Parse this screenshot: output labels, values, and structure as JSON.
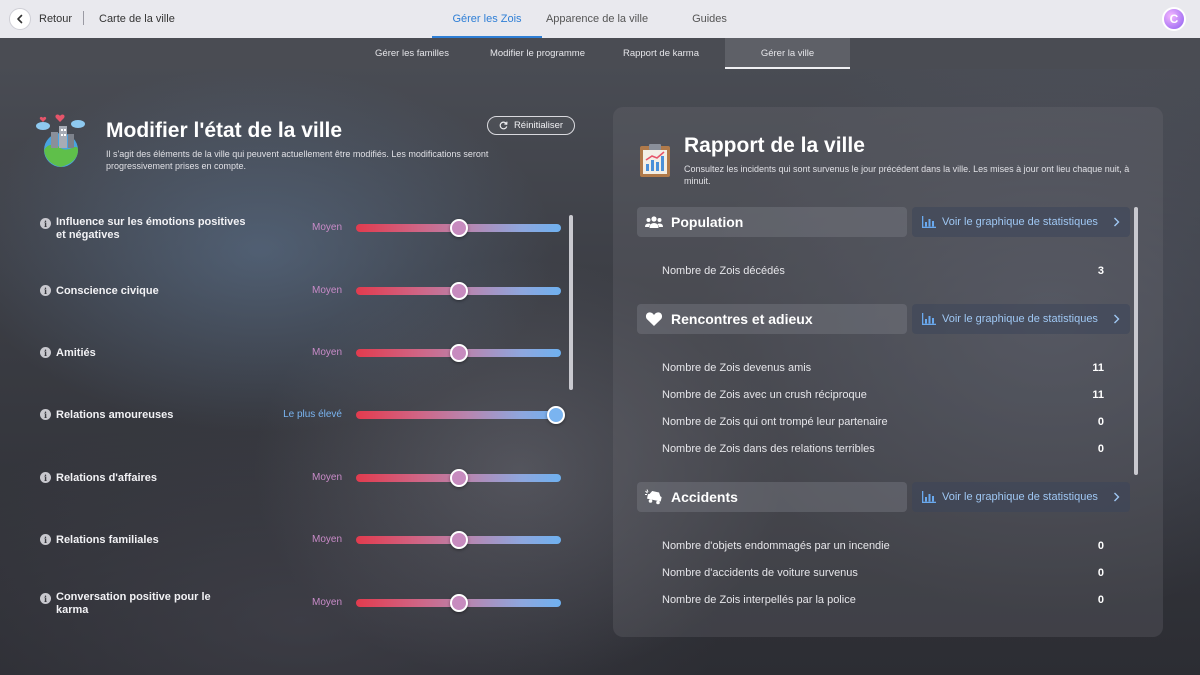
{
  "topbar": {
    "back_label": "Retour",
    "city_map_label": "Carte de la ville",
    "tabs": [
      {
        "label": "Gérer les Zois",
        "active": true
      },
      {
        "label": "Apparence de la ville",
        "active": false
      },
      {
        "label": "Guides",
        "active": false
      }
    ],
    "avatar_letter": "C"
  },
  "subtabs": [
    {
      "label": "Gérer les familles",
      "active": false
    },
    {
      "label": "Modifier le programme",
      "active": false
    },
    {
      "label": "Rapport de karma",
      "active": false
    },
    {
      "label": "Gérer la ville",
      "active": true
    }
  ],
  "left": {
    "title": "Modifier l'état de la ville",
    "description": "Il s'agit des éléments de la ville qui peuvent actuellement être modifiés. Les modifications seront progressivement prises en compte.",
    "reset_label": "Réinitialiser",
    "sliders": [
      {
        "label": "Influence sur les émotions positives et négatives",
        "value_label": "Moyen",
        "level": 0.5
      },
      {
        "label": "Conscience civique",
        "value_label": "Moyen",
        "level": 0.5
      },
      {
        "label": "Amitiés",
        "value_label": "Moyen",
        "level": 0.5
      },
      {
        "label": "Relations amoureuses",
        "value_label": "Le plus élevé",
        "level": 1.0
      },
      {
        "label": "Relations d'affaires",
        "value_label": "Moyen",
        "level": 0.5
      },
      {
        "label": "Relations familiales",
        "value_label": "Moyen",
        "level": 0.5
      },
      {
        "label": "Conversation positive pour le karma",
        "value_label": "Moyen",
        "level": 0.5
      }
    ]
  },
  "right": {
    "title": "Rapport de la ville",
    "description": "Consultez les incidents qui sont survenus le jour précédent dans la ville. Les mises à jour ont lieu chaque nuit, à minuit.",
    "stats_button_label": "Voir le graphique de statistiques",
    "sections": [
      {
        "label": "Population",
        "icon": "people-icon",
        "rows": [
          {
            "label": "Nombre de Zois décédés",
            "value": "3"
          }
        ]
      },
      {
        "label": "Rencontres et adieux",
        "icon": "heart-icon",
        "rows": [
          {
            "label": "Nombre de Zois devenus amis",
            "value": "11"
          },
          {
            "label": "Nombre de Zois avec un crush réciproque",
            "value": "11"
          },
          {
            "label": "Nombre de Zois qui ont trompé leur partenaire",
            "value": "0"
          },
          {
            "label": "Nombre de Zois dans des relations terribles",
            "value": "0"
          }
        ]
      },
      {
        "label": "Accidents",
        "icon": "car-crash-icon",
        "rows": [
          {
            "label": "Nombre d'objets endommagés par un incendie",
            "value": "0"
          },
          {
            "label": "Nombre d'accidents de voiture survenus",
            "value": "0"
          },
          {
            "label": "Nombre de Zois interpellés par la police",
            "value": "0"
          }
        ]
      }
    ]
  }
}
